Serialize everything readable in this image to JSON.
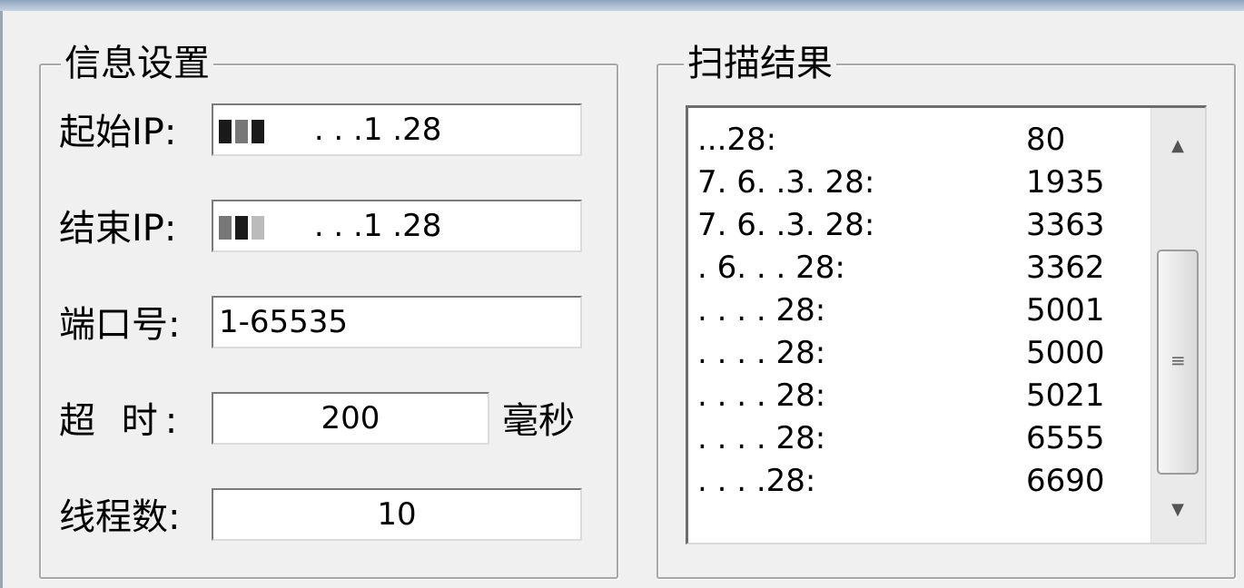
{
  "settings": {
    "group_title": "信息设置",
    "start_ip_label": "起始IP:",
    "start_ip_value": ". . .1 .28",
    "end_ip_label": "结束IP:",
    "end_ip_value": ". . .1 .28",
    "port_label": "端口号:",
    "port_value": "1-65535",
    "timeout_label": "超  时:",
    "timeout_value": "200",
    "timeout_unit": "毫秒",
    "threads_label": "线程数:",
    "threads_value": "10"
  },
  "results": {
    "group_title": "扫描结果",
    "rows": [
      {
        "ip": "...28:",
        "port": "80"
      },
      {
        "ip": "7. 6. .3. 28:",
        "port": "1935"
      },
      {
        "ip": "7. 6. .3. 28:",
        "port": "3363"
      },
      {
        "ip": ". 6. . . 28:",
        "port": "3362"
      },
      {
        "ip": ". . . . 28:",
        "port": "5001"
      },
      {
        "ip": ". . . . 28:",
        "port": "5000"
      },
      {
        "ip": ". . . . 28:",
        "port": "5021"
      },
      {
        "ip": ". . . . 28:",
        "port": "6555"
      },
      {
        "ip": ". . . .28:",
        "port": "6690"
      }
    ]
  },
  "icons": {
    "scroll_up": "triangle-up",
    "scroll_down": "triangle-down",
    "grip": "grip-lines"
  }
}
